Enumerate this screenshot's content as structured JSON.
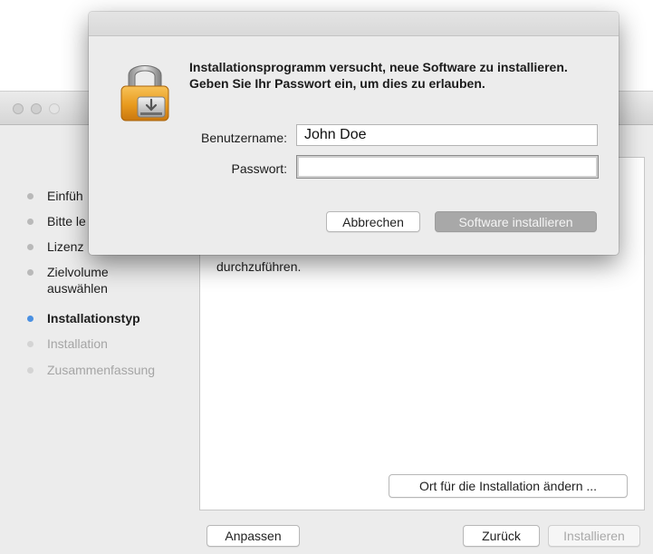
{
  "sidebar": {
    "items": [
      {
        "label": "Einführung",
        "state": "normal"
      },
      {
        "label": "Bitte lesen",
        "state": "normal"
      },
      {
        "label": "Lizenz",
        "state": "normal"
      },
      {
        "label": "Zielvolume auswählen",
        "state": "normal"
      },
      {
        "label": "Installationstyp",
        "state": "active"
      },
      {
        "label": "Installation",
        "state": "disabled"
      },
      {
        "label": "Zusammenfassung",
        "state": "disabled"
      }
    ],
    "visible": {
      "item0": "Einfüh",
      "item1": "Bitte le",
      "item2": "Lizenz",
      "item3_line1": "Zielvolume",
      "item3_line2": "auswählen",
      "item4": "Installationstyp",
      "item5": "Installation",
      "item6": "Zusammenfassung"
    }
  },
  "content": {
    "text": "durchzuführen."
  },
  "buttons": {
    "change_location": "Ort für die Installation ändern ...",
    "customize": "Anpassen",
    "back": "Zurück",
    "install": "Installieren"
  },
  "dialog": {
    "message": "Installationsprogramm versucht, neue Software zu installieren. Geben Sie Ihr Passwort ein, um dies zu erlauben.",
    "username_label": "Benutzername:",
    "username_value": "John Doe",
    "password_label": "Passwort:",
    "password_value": "",
    "cancel_label": "Abbrechen",
    "confirm_label": "Software installieren"
  },
  "colors": {
    "active_dot": "#4a90e2",
    "window_bg": "#ececec"
  }
}
